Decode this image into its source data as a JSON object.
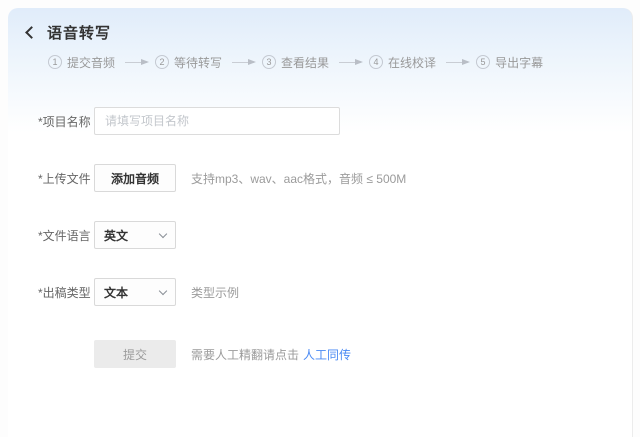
{
  "header": {
    "title": "语音转写"
  },
  "steps": [
    {
      "num": "1",
      "label": "提交音频"
    },
    {
      "num": "2",
      "label": "等待转写"
    },
    {
      "num": "3",
      "label": "查看结果"
    },
    {
      "num": "4",
      "label": "在线校译"
    },
    {
      "num": "5",
      "label": "导出字幕"
    }
  ],
  "form": {
    "project_name": {
      "label": "*项目名称",
      "placeholder": "请填写项目名称",
      "value": ""
    },
    "upload": {
      "label": "*上传文件",
      "button_label": "添加音频",
      "hint": "支持mp3、wav、aac格式，音频 ≤ 500M"
    },
    "language": {
      "label": "*文件语言",
      "selected": "英文"
    },
    "output_type": {
      "label": "*出稿类型",
      "selected": "文本",
      "example_label": "类型示例"
    },
    "submit": {
      "button_label": "提交",
      "hint": "需要人工精翻请点击",
      "link_label": "人工同传"
    }
  },
  "colors": {
    "link_blue": "#4a8af4",
    "card_gradient_top": "#e0ecfa",
    "border_gray": "#d9d9d9",
    "label_gray": "#666666",
    "hint_gray": "#9b9b9b"
  }
}
